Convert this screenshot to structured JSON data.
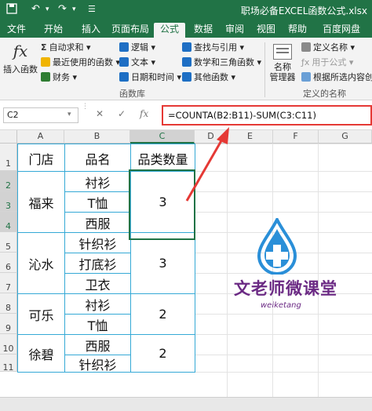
{
  "window": {
    "title": "职场必备EXCEL函数公式.xlsx"
  },
  "tabs": [
    {
      "label": "文件"
    },
    {
      "label": "开始"
    },
    {
      "label": "插入"
    },
    {
      "label": "页面布局"
    },
    {
      "label": "公式",
      "active": true
    },
    {
      "label": "数据"
    },
    {
      "label": "审阅"
    },
    {
      "label": "视图"
    },
    {
      "label": "帮助"
    },
    {
      "label": "百度网盘"
    }
  ],
  "ribbon": {
    "insert_function": "插入函数",
    "autosum": "自动求和",
    "recent": "最近使用的函数",
    "financial": "财务",
    "logical": "逻辑",
    "text": "文本",
    "datetime": "日期和时间",
    "lookup": "查找与引用",
    "math": "数学和三角函数",
    "more": "其他函数",
    "group_library": "函数库",
    "name_manager": "名称\n管理器",
    "define_name": "定义名称",
    "use_in_formula": "用于公式",
    "create_from_selection": "根据所选内容创建",
    "group_defined_names": "定义的名称"
  },
  "formula_bar": {
    "name_box": "C2",
    "fx": "fx",
    "formula": "=COUNTA(B2:B11)-SUM(C3:C11)"
  },
  "columns": [
    "A",
    "B",
    "C",
    "D",
    "E",
    "F",
    "G"
  ],
  "rows": [
    "1",
    "2",
    "3",
    "4",
    "5",
    "6",
    "7",
    "8",
    "9",
    "10",
    "11"
  ],
  "table": {
    "headers": {
      "store": "门店",
      "product": "品名",
      "count": "品类数量"
    },
    "groups": [
      {
        "store": "福来",
        "count": "3",
        "products": [
          "衬衫",
          "T恤",
          "西服"
        ]
      },
      {
        "store": "沁水",
        "count": "3",
        "products": [
          "针织衫",
          "打底衫",
          "卫衣"
        ]
      },
      {
        "store": "可乐",
        "count": "2",
        "products": [
          "衬衫",
          "T恤"
        ]
      },
      {
        "store": "徐碧",
        "count": "2",
        "products": [
          "西服",
          "针织衫"
        ]
      }
    ]
  },
  "watermark": {
    "text": "文老师微课堂",
    "sub": "weiketang"
  },
  "colors": {
    "excel_green": "#217346",
    "table_border": "#35a9d6",
    "annotation_red": "#e53935",
    "watermark_blue": "#2a8fd8",
    "watermark_purple": "#6b2a84"
  }
}
